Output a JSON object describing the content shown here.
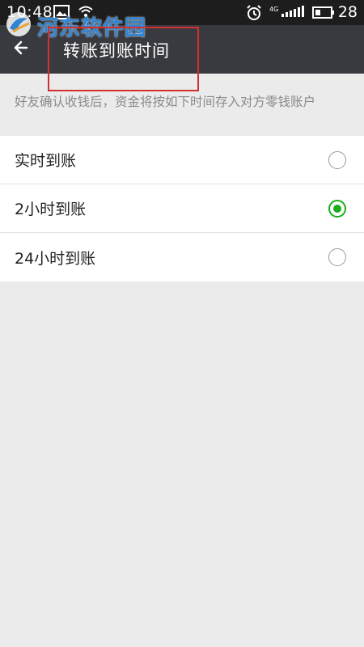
{
  "status_bar": {
    "time": "10:48",
    "signal_label": "4G",
    "battery": "28"
  },
  "watermark": {
    "text": "河东软件园"
  },
  "title_bar": {
    "title": "转账到账时间"
  },
  "description": "好友确认收钱后，资金将按如下时间存入对方零钱账户",
  "options": [
    {
      "label": "实时到账",
      "selected": false
    },
    {
      "label": "2小时到账",
      "selected": true
    },
    {
      "label": "24小时到账",
      "selected": false
    }
  ],
  "colors": {
    "accent": "#1aad19",
    "title_bar": "#393a3f",
    "highlight": "#d32f2f"
  }
}
